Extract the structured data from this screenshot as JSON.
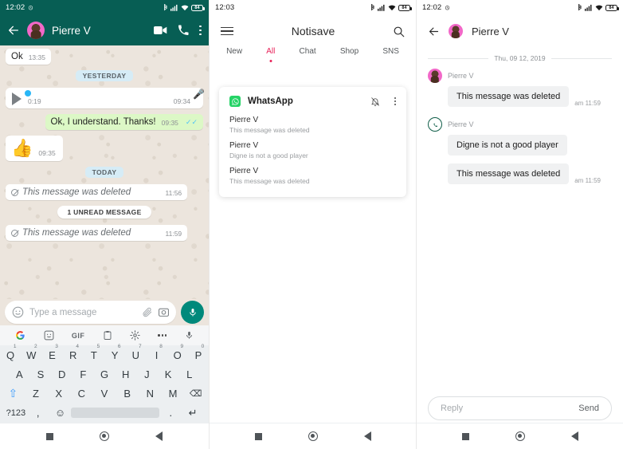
{
  "panel1": {
    "status": {
      "time": "12:02",
      "alarm_icon": "alarm-icon",
      "battery": "84"
    },
    "header": {
      "back_icon": "back-arrow-icon",
      "avatar": "contact-avatar",
      "title": "Pierre V",
      "video_icon": "video-call-icon",
      "call_icon": "voice-call-icon",
      "menu_icon": "overflow-menu-icon"
    },
    "messages": [
      {
        "type": "in-text",
        "text": "Ok",
        "time": "13:35"
      },
      {
        "type": "day",
        "text": "YESTERDAY"
      },
      {
        "type": "voice",
        "elapsed": "0:19",
        "time": "09:34"
      },
      {
        "type": "out-text",
        "text": "Ok, I understand. Thanks!",
        "time": "09:35",
        "ticks": "✓✓"
      },
      {
        "type": "emoji",
        "emoji": "👍",
        "time": "09:35"
      },
      {
        "type": "day",
        "text": "TODAY"
      },
      {
        "type": "deleted",
        "text": "This message was deleted",
        "time": "11:56"
      },
      {
        "type": "unread",
        "text": "1 UNREAD MESSAGE"
      },
      {
        "type": "deleted",
        "text": "This message was deleted",
        "time": "11:59"
      }
    ],
    "composer": {
      "emoji_icon": "emoji-icon",
      "placeholder": "Type a message",
      "attach_icon": "attachment-clip-icon",
      "camera_icon": "camera-icon",
      "mic_icon": "microphone-icon"
    },
    "keyboard": {
      "toolbar": [
        "google-icon",
        "sticker-icon",
        "GIF",
        "clipboard-icon",
        "settings-gear-icon",
        "more-dots-icon",
        "microphone-icon"
      ],
      "row1": [
        {
          "k": "Q",
          "n": "1"
        },
        {
          "k": "W",
          "n": "2"
        },
        {
          "k": "E",
          "n": "3"
        },
        {
          "k": "R",
          "n": "4"
        },
        {
          "k": "T",
          "n": "5"
        },
        {
          "k": "Y",
          "n": "6"
        },
        {
          "k": "U",
          "n": "7"
        },
        {
          "k": "I",
          "n": "8"
        },
        {
          "k": "O",
          "n": "9"
        },
        {
          "k": "P",
          "n": "0"
        }
      ],
      "row2": [
        "A",
        "S",
        "D",
        "F",
        "G",
        "H",
        "J",
        "K",
        "L"
      ],
      "row3": [
        "Z",
        "X",
        "C",
        "V",
        "B",
        "N",
        "M"
      ],
      "shift": "⇧",
      "backspace": "⌫",
      "numeric": "?123",
      "comma": ",",
      "emoji": "☺",
      "period": ".",
      "enter": "↵"
    },
    "nav": {
      "recents": "recents-square-icon",
      "home": "home-circle-icon",
      "back": "back-triangle-icon"
    }
  },
  "panel2": {
    "status": {
      "time": "12:03",
      "battery": "84"
    },
    "header": {
      "menu_icon": "hamburger-menu-icon",
      "title": "Notisave",
      "search_icon": "search-icon"
    },
    "tabs": [
      {
        "label": "New",
        "active": false
      },
      {
        "label": "All",
        "active": true
      },
      {
        "label": "Chat",
        "active": false
      },
      {
        "label": "Shop",
        "active": false
      },
      {
        "label": "SNS",
        "active": false
      }
    ],
    "card": {
      "app_icon": "whatsapp-icon",
      "app_name": "WhatsApp",
      "mute_icon": "notification-off-icon",
      "menu_icon": "overflow-menu-icon",
      "items": [
        {
          "name": "Pierre V",
          "preview": "This message was deleted"
        },
        {
          "name": "Pierre V",
          "preview": "Digne is not a good player"
        },
        {
          "name": "Pierre V",
          "preview": "This message was deleted"
        }
      ]
    },
    "nav": {
      "recents": "recents-square-icon",
      "home": "home-circle-icon",
      "back": "back-triangle-icon"
    }
  },
  "panel3": {
    "status": {
      "time": "12:02",
      "alarm_icon": "alarm-icon",
      "battery": "84"
    },
    "header": {
      "back_icon": "back-arrow-icon",
      "avatar": "contact-avatar",
      "title": "Pierre V"
    },
    "date_divider": "Thu, 09 12, 2019",
    "messages": [
      {
        "icon": "contact-avatar",
        "sender": "Pierre V",
        "text": "This message was deleted",
        "time": "am 11:59"
      },
      {
        "icon": "whatsapp-icon",
        "sender": "Pierre V",
        "text": "Digne is not a good player",
        "time": ""
      },
      {
        "icon": "",
        "sender": "",
        "text": "This message was deleted",
        "time": "am 11:59"
      }
    ],
    "reply": {
      "placeholder": "Reply",
      "send_label": "Send"
    },
    "nav": {
      "recents": "recents-square-icon",
      "home": "home-circle-icon",
      "back": "back-triangle-icon"
    }
  }
}
